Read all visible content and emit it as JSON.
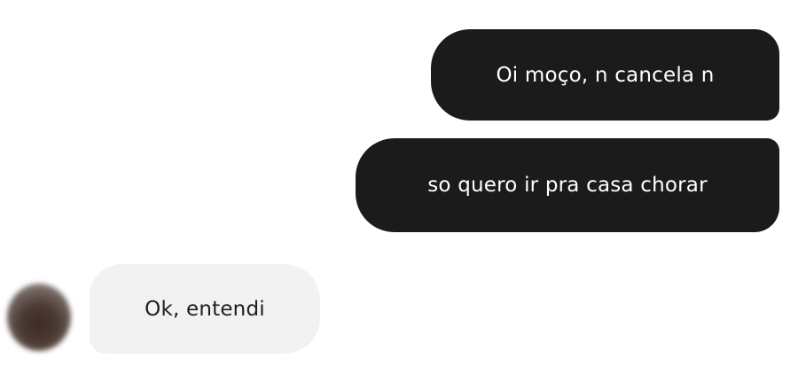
{
  "messages": [
    {
      "direction": "sent",
      "text": "Oi moço, n cancela n"
    },
    {
      "direction": "sent",
      "text": "so quero ir pra casa chorar"
    },
    {
      "direction": "received",
      "text": "Ok, entendi"
    }
  ],
  "colors": {
    "sent_bubble": "#1b1b1b",
    "sent_text": "#ffffff",
    "received_bubble": "#f2f2f2",
    "received_text": "#1e1e1e"
  },
  "icons": {
    "avatar": "blurred-profile-avatar"
  }
}
